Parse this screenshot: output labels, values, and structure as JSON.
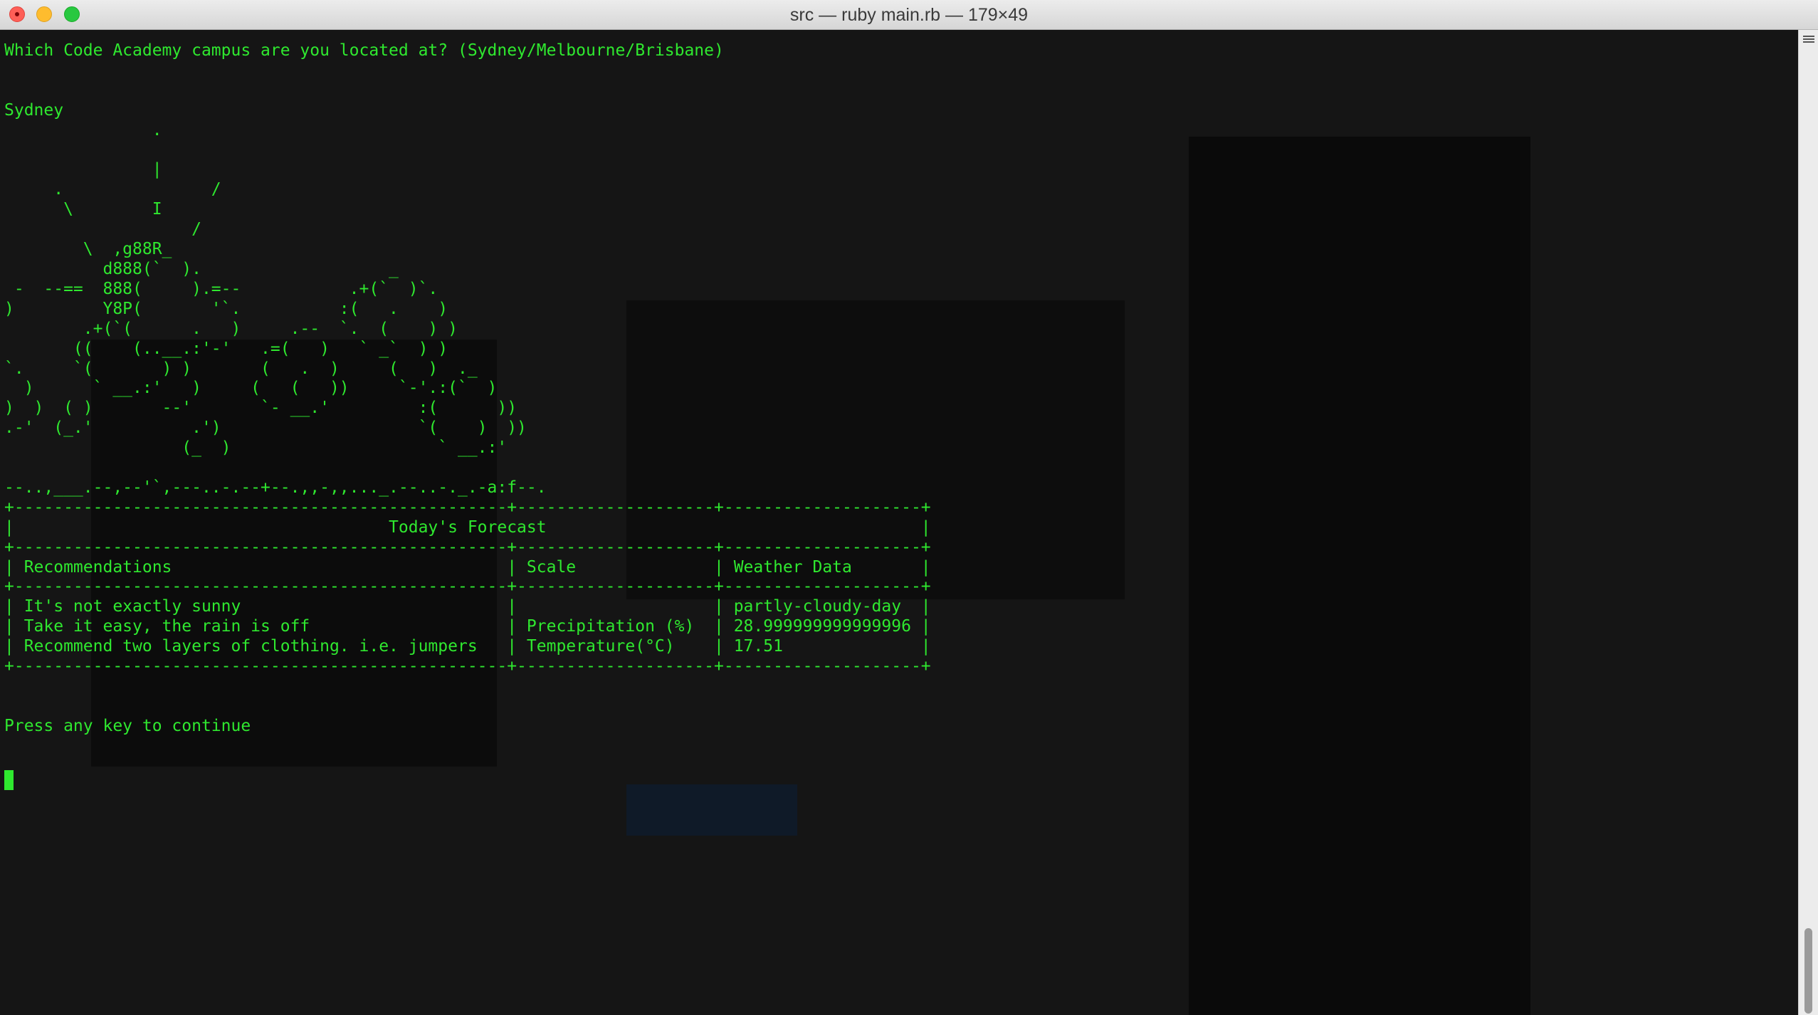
{
  "window": {
    "title": "src — ruby main.rb — 179×49"
  },
  "terminal": {
    "lines": [
      "Which Code Academy campus are you located at? (Sydney/Melbourne/Brisbane)",
      "",
      "",
      "Sydney",
      "               .",
      "",
      "               |",
      "     .               /",
      "      \\        I",
      "                   /",
      "        \\  ,g88R_",
      "          d888(`  ).                   _",
      " -  --==  888(     ).=--           .+(`  )`.",
      ")         Y8P(       '`.          :(   .    )",
      "        .+(`(      .   )     .--  `.  (    ) )",
      "       ((    (..__.:'-'   .=(   )   ` _`  ) )",
      "`.     `(       ) )       (   .  )     (   )  ._",
      "  )      ` __.:'   )     (   (   ))     `-'.:(`  )",
      ")  )  ( )       --'       `- __.'         :(      ))",
      ".-'  (_.'          .')                    `(    )  ))",
      "                  (_  )                     ` __.:'",
      "",
      "--..,___.--,--'`,---..-.--+--.,,-,,..._.--..-._.-a:f--.",
      "+--------------------------------------------------+--------------------+--------------------+",
      "|                                      Today's Forecast                                      |",
      "+--------------------------------------------------+--------------------+--------------------+",
      "| Recommendations                                  | Scale              | Weather Data       |",
      "+--------------------------------------------------+--------------------+--------------------+",
      "| It's not exactly sunny                           |                    | partly-cloudy-day  |",
      "| Take it easy, the rain is off                    | Precipitation (%)  | 28.999999999999996 |",
      "| Recommend two layers of clothing. i.e. jumpers   | Temperature(°C)    | 17.51              |",
      "+--------------------------------------------------+--------------------+--------------------+",
      "",
      "",
      "Press any key to continue"
    ]
  }
}
